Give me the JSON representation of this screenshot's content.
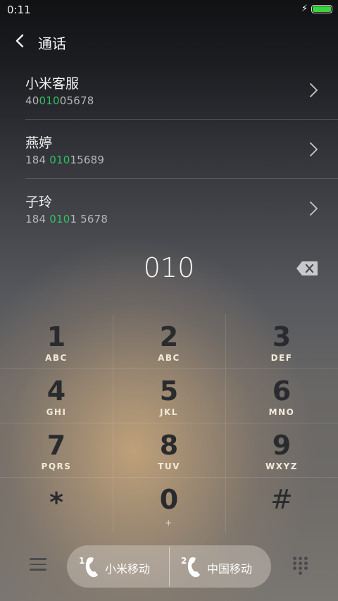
{
  "status_bar": {
    "time": "0:11"
  },
  "header": {
    "title": "通话"
  },
  "contacts": [
    {
      "name": "小米客服",
      "number_prefix": "40",
      "number_match": "010",
      "number_suffix": "05678"
    },
    {
      "name": "燕婷",
      "number_prefix": "184 ",
      "number_match": "010",
      "number_suffix": "15689"
    },
    {
      "name": "子玲",
      "number_prefix": "184 ",
      "number_match": "010",
      "number_suffix": "1 5678"
    }
  ],
  "dialer": {
    "input": "010"
  },
  "keypad": [
    {
      "digit": "1",
      "letters": "ABC"
    },
    {
      "digit": "2",
      "letters": "ABC"
    },
    {
      "digit": "3",
      "letters": "DEF"
    },
    {
      "digit": "4",
      "letters": "GHI"
    },
    {
      "digit": "5",
      "letters": "JKL"
    },
    {
      "digit": "6",
      "letters": "MNO"
    },
    {
      "digit": "7",
      "letters": "PQRS"
    },
    {
      "digit": "8",
      "letters": "TUV"
    },
    {
      "digit": "9",
      "letters": "WXYZ"
    },
    {
      "digit": "*",
      "letters": ""
    },
    {
      "digit": "0",
      "letters": "+"
    },
    {
      "digit": "#",
      "letters": ""
    }
  ],
  "sim_buttons": [
    {
      "slot": "1",
      "label": "小米移动"
    },
    {
      "slot": "2",
      "label": "中国移动"
    }
  ],
  "colors": {
    "match_highlight": "#33c060",
    "battery": "#3ad33f"
  }
}
